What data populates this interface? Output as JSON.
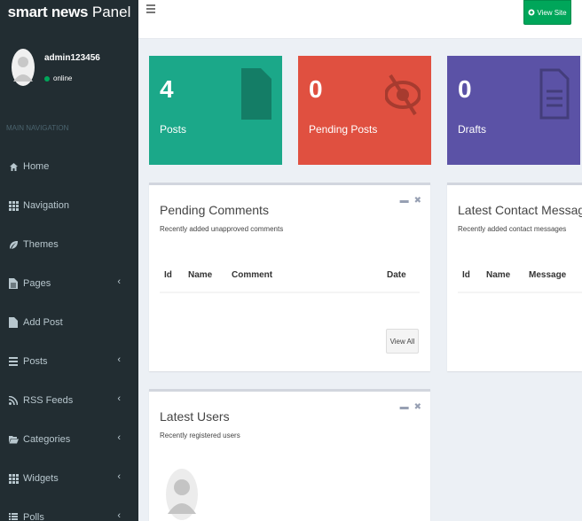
{
  "app": {
    "title_bold": "smart news",
    "title_light": "Panel"
  },
  "user": {
    "name": "admin123456",
    "status": "online"
  },
  "nav": {
    "header": "MAIN NAVIGATION",
    "items": [
      {
        "label": "Home",
        "icon": "home-icon",
        "has_caret": false
      },
      {
        "label": "Navigation",
        "icon": "grid-icon",
        "has_caret": false
      },
      {
        "label": "Themes",
        "icon": "leaf-icon",
        "has_caret": false
      },
      {
        "label": "Pages",
        "icon": "file-text-icon",
        "has_caret": true
      },
      {
        "label": "Add Post",
        "icon": "file-icon",
        "has_caret": false
      },
      {
        "label": "Posts",
        "icon": "list-icon",
        "has_caret": true
      },
      {
        "label": "RSS Feeds",
        "icon": "rss-icon",
        "has_caret": true
      },
      {
        "label": "Categories",
        "icon": "folder-open-icon",
        "has_caret": true
      },
      {
        "label": "Widgets",
        "icon": "grid-icon",
        "has_caret": true
      },
      {
        "label": "Polls",
        "icon": "list-alt-icon",
        "has_caret": true
      }
    ]
  },
  "topbar": {
    "view_site_label": "View Site"
  },
  "stats": [
    {
      "value": "4",
      "label": "Posts",
      "color": "#1ba889"
    },
    {
      "value": "0",
      "label": "Pending Posts",
      "color": "#e05040"
    },
    {
      "value": "0",
      "label": "Drafts",
      "color": "#5b52a6"
    }
  ],
  "pending_comments": {
    "title": "Pending Comments",
    "subtitle": "Recently added unapproved comments",
    "columns": [
      "Id",
      "Name",
      "Comment",
      "Date"
    ],
    "view_all_label": "View All"
  },
  "contact_messages": {
    "title": "Latest Contact Messages",
    "subtitle": "Recently added contact messages",
    "columns": [
      "Id",
      "Name",
      "Message"
    ]
  },
  "latest_users": {
    "title": "Latest Users",
    "subtitle": "Recently registered users"
  },
  "colors": {
    "sidebar": "#222d32",
    "accent_green": "#00a65a",
    "body_bg": "#ecf0f5"
  }
}
